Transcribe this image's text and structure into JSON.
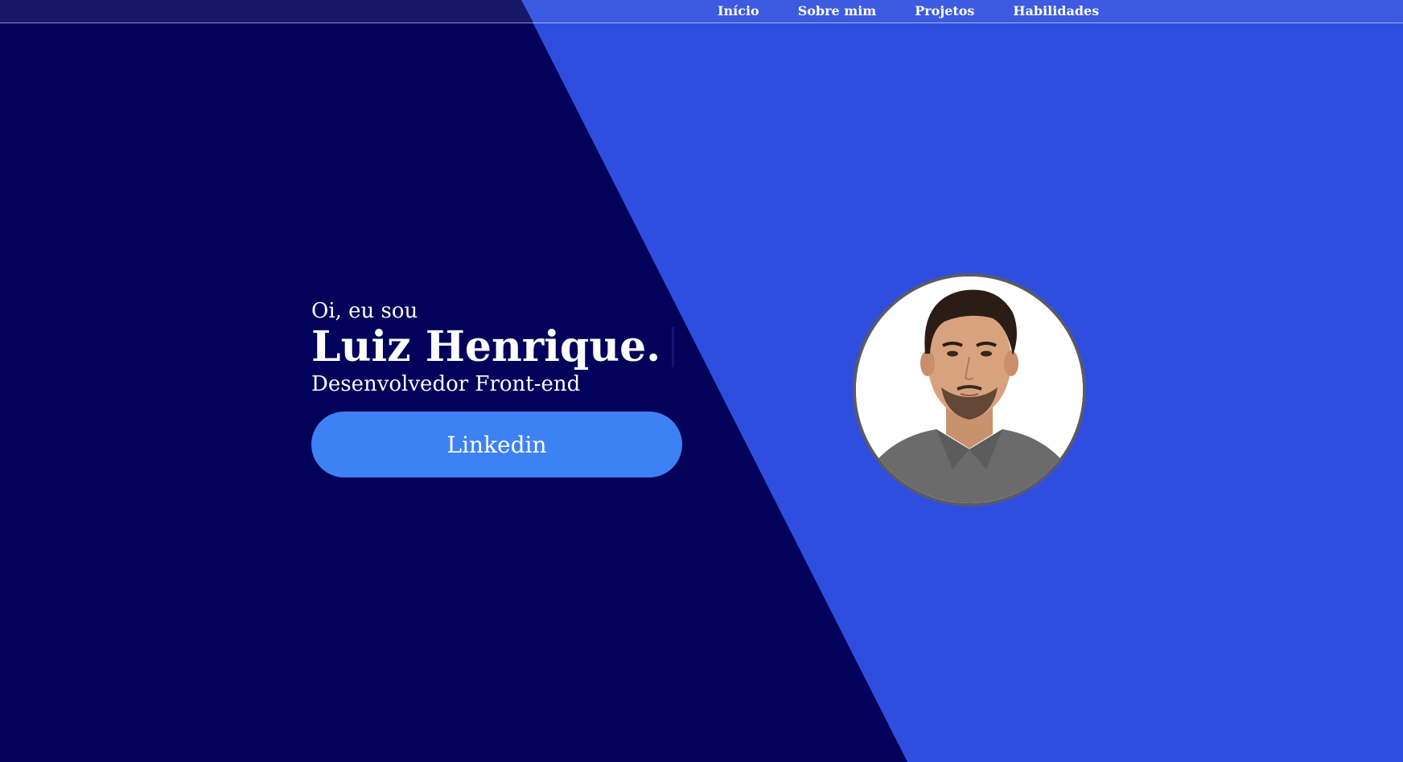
{
  "nav": {
    "items": [
      {
        "label": "Início"
      },
      {
        "label": "Sobre mim"
      },
      {
        "label": "Projetos"
      },
      {
        "label": "Habilidades"
      }
    ]
  },
  "hero": {
    "greeting": "Oi, eu sou",
    "name": "Luiz Henrique.",
    "role": "Desenvolvedor Front-end",
    "button_label": "Linkedin"
  },
  "colors": {
    "dark_panel": "#03025a",
    "light_panel": "#2f4ee0",
    "button": "#3d82f4",
    "text": "#ffffff"
  },
  "avatar": {
    "icon": "profile-photo"
  }
}
